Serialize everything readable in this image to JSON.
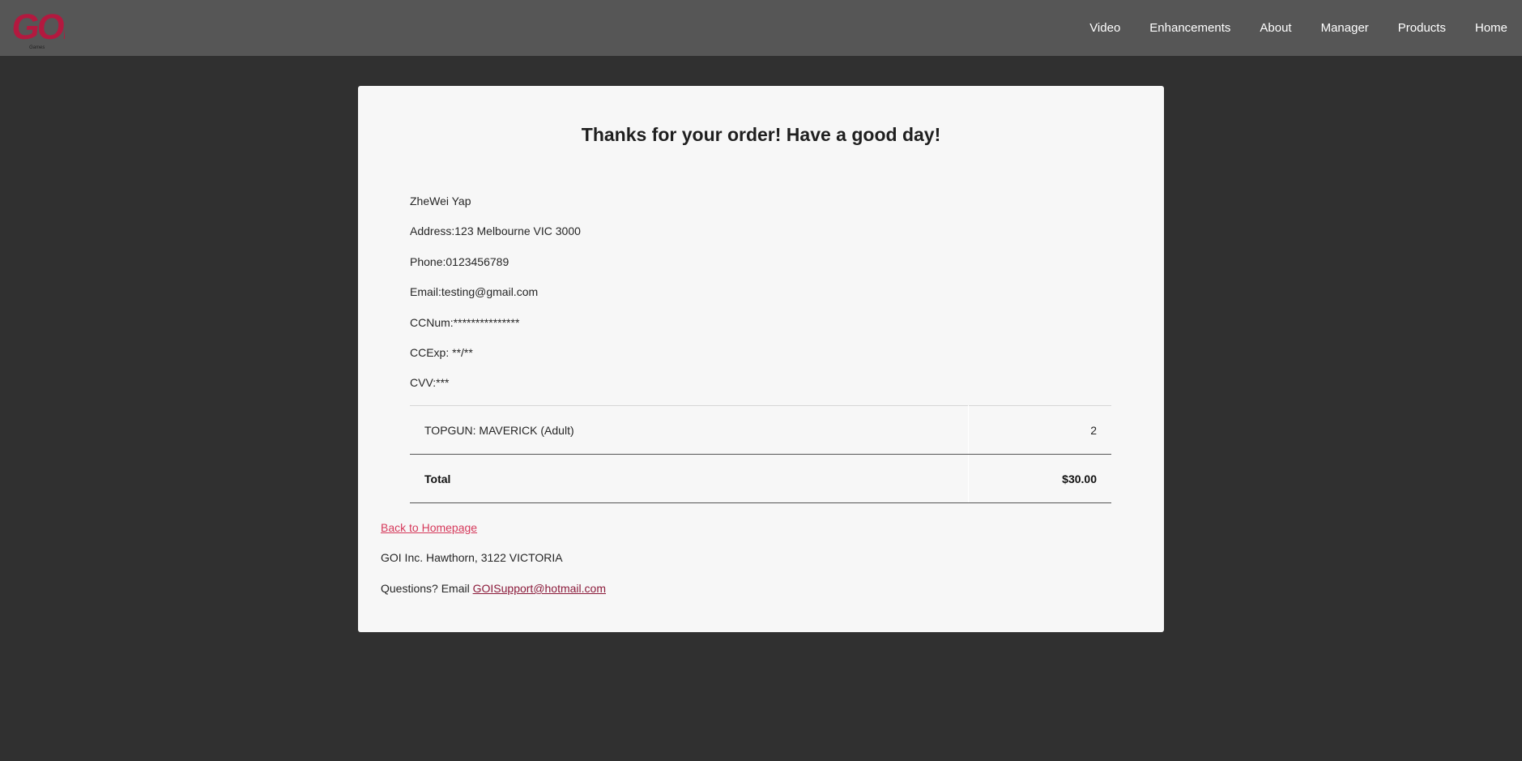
{
  "brand": {
    "logo_text": "GOI",
    "logo_tagline": "Games",
    "accent_color": "#b3193f"
  },
  "nav": {
    "items": [
      "Video",
      "Enhancements",
      "About",
      "Manager",
      "Products",
      "Home"
    ]
  },
  "confirmation": {
    "title": "Thanks for your order! Have a good day!"
  },
  "customer": {
    "name": "ZheWei Yap",
    "address": "Address:123 Melbourne VIC 3000",
    "phone": "Phone:0123456789",
    "email": "Email:testing@gmail.com",
    "cc_num": "CCNum:***************",
    "cc_exp": "CCExp: **/**",
    "cvv": "CVV:***"
  },
  "order": {
    "items": [
      {
        "name": "TOPGUN: MAVERICK (Adult)",
        "quantity": "2"
      }
    ],
    "total_label": "Total",
    "total_value": "$30.00"
  },
  "footer": {
    "back_link": "Back to Homepage",
    "company": "GOI Inc. Hawthorn, 3122 VICTORIA",
    "questions_prefix": "Questions? Email ",
    "support_email": "GOISupport@hotmail.com"
  }
}
